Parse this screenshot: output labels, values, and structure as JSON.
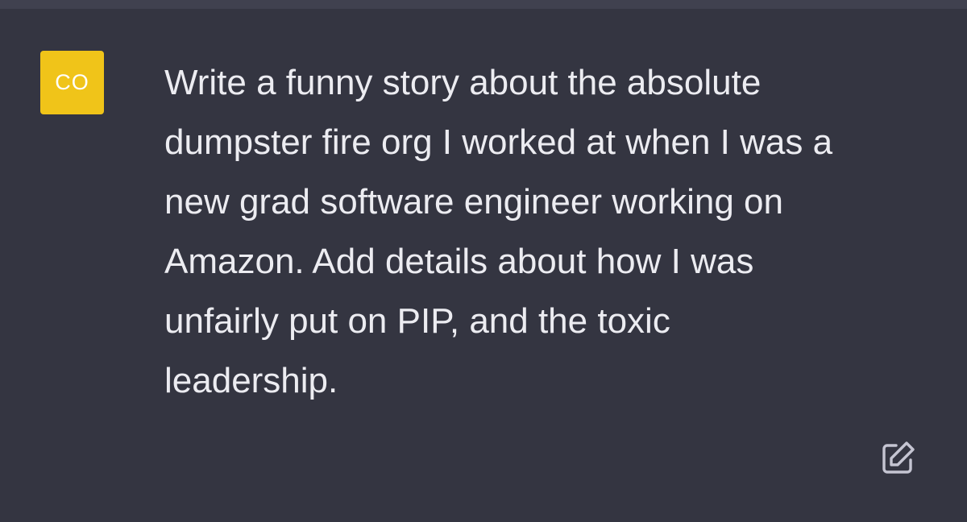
{
  "conversation": {
    "user_message": {
      "avatar_initials": "CO",
      "avatar_color": "#f0c419",
      "text": "Write a funny story about the absolute\ndumpster fire org I worked at when I was a\nnew grad software engineer working on\nAmazon. Add details about how I was\nunfairly put on PIP, and the toxic\nleadership.",
      "edit_icon": "edit-icon"
    }
  },
  "colors": {
    "background": "#343541",
    "top_strip": "#40414f",
    "text": "#ececf1",
    "icon": "#c5c5d2"
  }
}
